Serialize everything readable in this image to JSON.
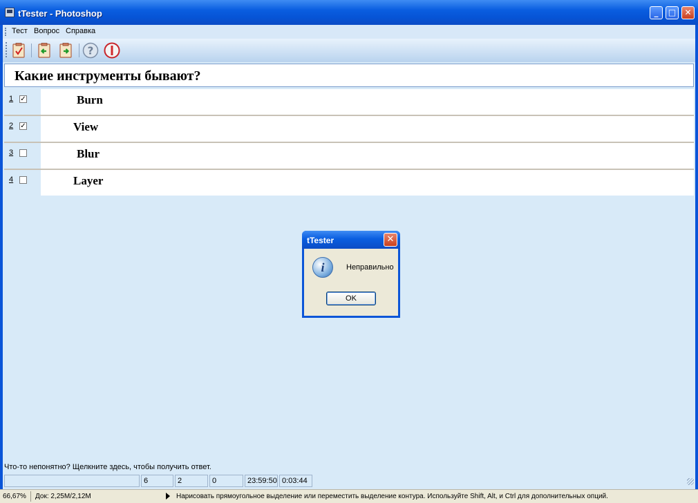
{
  "window": {
    "title": "tTester - Photoshop"
  },
  "title_buttons": {
    "minimize": "_",
    "maximize": "□",
    "close": "✕"
  },
  "menu": [
    "Тест",
    "Вопрос",
    "Справка"
  ],
  "toolbar": [
    "checklist-icon",
    "back-icon",
    "forward-icon",
    "help-icon",
    "stop-icon"
  ],
  "question": {
    "text": "Какие инструменты бывают?"
  },
  "answers": [
    {
      "num": "1",
      "checked": true,
      "text": "Burn"
    },
    {
      "num": "2",
      "checked": true,
      "text": "View"
    },
    {
      "num": "3",
      "checked": false,
      "text": "Blur"
    },
    {
      "num": "4",
      "checked": false,
      "text": "Layer"
    }
  ],
  "dialog": {
    "title": "tTester",
    "message": "Неправильно",
    "ok": "OK",
    "close": "✕",
    "icon": "i"
  },
  "hint": "Что-то непонятно? Щелкните здесь, чтобы получить ответ.",
  "status": {
    "c1": "",
    "c2": "6",
    "c3": "2",
    "c4": "0",
    "c5": "23:59:50",
    "c6": "0:03:44"
  },
  "ps_status": {
    "zoom": "66,67%",
    "doc": "Док: 2,25M/2,12M",
    "info": "Нарисовать прямоугольное выделение или переместить выделение контура.  Используйте Shift, Alt, и Ctrl для дополнительных опций."
  }
}
